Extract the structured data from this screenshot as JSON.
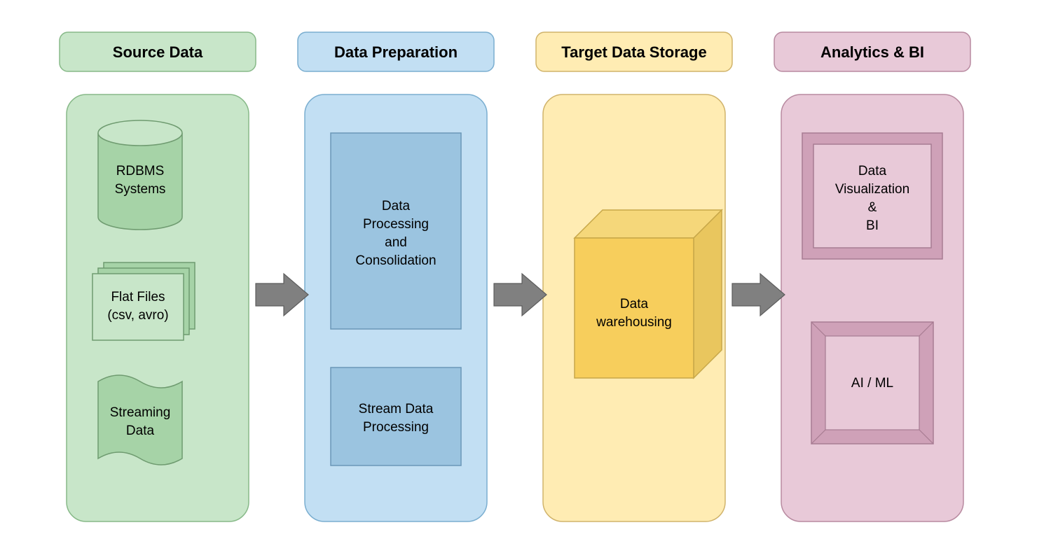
{
  "columns": {
    "source": {
      "title": "Source Data",
      "items": {
        "rdbms": "RDBMS\nSystems",
        "flat": "Flat Files\n(csv, avro)",
        "stream": "Streaming\nData"
      },
      "colors": {
        "fill": "#c8e6c9",
        "stroke": "#87b988",
        "darker": "#a6d3a7"
      }
    },
    "prep": {
      "title": "Data Preparation",
      "items": {
        "batch": "Data\nProcessing\nand\nConsolidation",
        "stream": "Stream Data\nProcessing"
      },
      "colors": {
        "fill": "#c2dff3",
        "stroke": "#7aaed0",
        "darker": "#9bc4e0"
      }
    },
    "target": {
      "title": "Target Data Storage",
      "items": {
        "dw": "Data\nwarehousing"
      },
      "colors": {
        "fill": "#ffecb3",
        "stroke": "#d0b36b",
        "darker": "#f5d77a",
        "face": "#f7ce5c"
      }
    },
    "analytics": {
      "title": "Analytics & BI",
      "items": {
        "viz": "Data\nVisualization\n&\nBI",
        "ml": "AI / ML"
      },
      "colors": {
        "fill": "#e8c9d8",
        "stroke": "#b88aa0",
        "darker": "#cfa1b8"
      }
    }
  },
  "arrow_color": "#808080"
}
